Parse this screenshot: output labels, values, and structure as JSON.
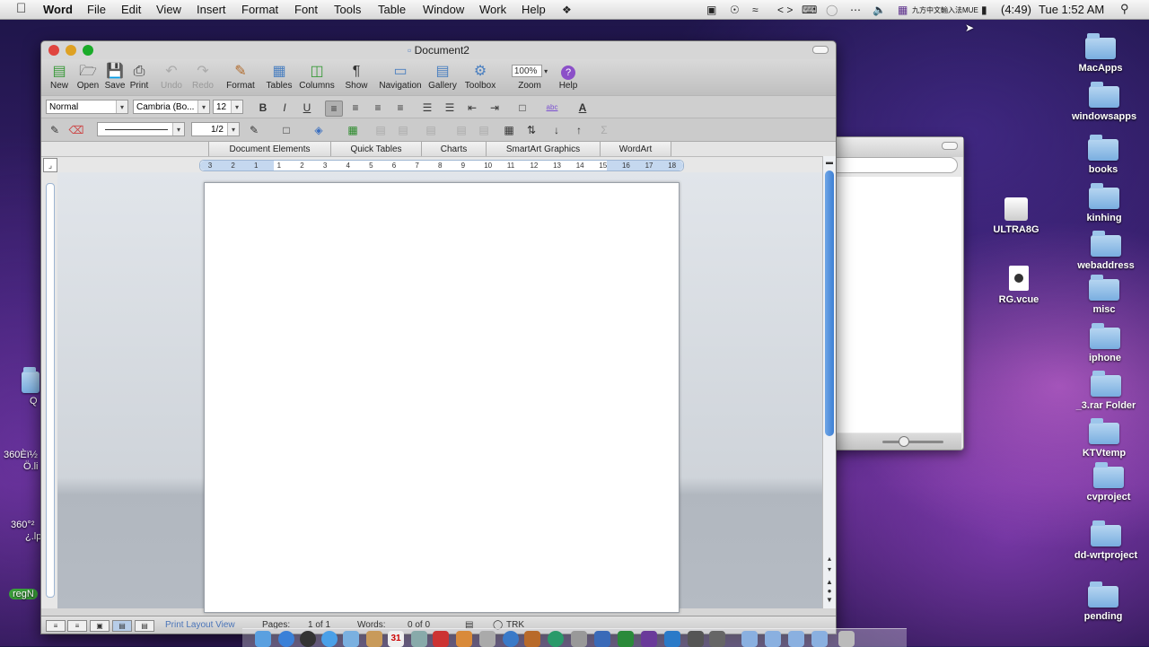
{
  "menubar": {
    "app": "Word",
    "items": [
      "File",
      "Edit",
      "View",
      "Insert",
      "Format",
      "Font",
      "Tools",
      "Table",
      "Window",
      "Work",
      "Help"
    ],
    "battery": "(4:49)",
    "clock": "Tue 1:52 AM",
    "input_method": "九方中文輸入法MUE"
  },
  "desktop": {
    "icons": [
      {
        "label": "MacApps",
        "kind": "folder"
      },
      {
        "label": "windowsapps",
        "kind": "folder"
      },
      {
        "label": "books",
        "kind": "folder"
      },
      {
        "label": "kinhing",
        "kind": "folder"
      },
      {
        "label": "ULTRA8G",
        "kind": "drive"
      },
      {
        "label": "webaddress",
        "kind": "folder"
      },
      {
        "label": "RG.vcue",
        "kind": "document"
      },
      {
        "label": "misc",
        "kind": "folder"
      },
      {
        "label": "iphone",
        "kind": "folder"
      },
      {
        "label": "_3.rar Folder",
        "kind": "folder"
      },
      {
        "label": "KTVtemp",
        "kind": "folder"
      },
      {
        "label": "cvproject",
        "kind": "folder"
      },
      {
        "label": "dd-wrtproject",
        "kind": "folder"
      },
      {
        "label": "pending",
        "kind": "folder"
      }
    ],
    "left_partial": [
      "Q",
      "360Èï½",
      "Ö.li",
      "360°²",
      "¿.lp",
      "regN"
    ]
  },
  "window": {
    "title": "Document2",
    "toolbar": {
      "new": "New",
      "open": "Open",
      "save": "Save",
      "print": "Print",
      "undo": "Undo",
      "redo": "Redo",
      "format": "Format",
      "tables": "Tables",
      "columns": "Columns",
      "show": "Show",
      "navigation": "Navigation",
      "gallery": "Gallery",
      "toolbox": "Toolbox",
      "zoom": "Zoom",
      "help": "Help",
      "zoom_value": "100%"
    },
    "formatting": {
      "style": "Normal",
      "font": "Cambria (Bo...",
      "size": "12",
      "line_spacing": "1/2"
    },
    "ribbon_tabs": [
      "Document Elements",
      "Quick Tables",
      "Charts",
      "SmartArt Graphics",
      "WordArt"
    ],
    "ruler_numbers": [
      "3",
      "2",
      "1",
      "1",
      "2",
      "3",
      "4",
      "5",
      "6",
      "7",
      "8",
      "9",
      "10",
      "11",
      "12",
      "13",
      "14",
      "15",
      "16",
      "17",
      "18"
    ],
    "status": {
      "view": "Print Layout View",
      "pages_label": "Pages:",
      "pages_value": "1 of 1",
      "words_label": "Words:",
      "words_value": "0 of 0",
      "trk": "TRK"
    }
  },
  "colors": {
    "accent": "#3d7fd4",
    "ruler": "#c5d8ef",
    "highlight": "#ff33cc",
    "font_color": "#cc0000"
  }
}
